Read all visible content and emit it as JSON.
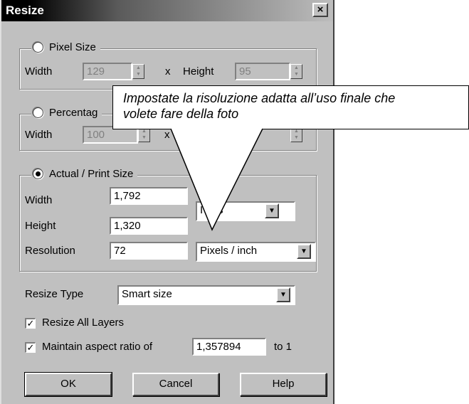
{
  "window": {
    "title": "Resize",
    "close_glyph": "×"
  },
  "pixel_size": {
    "label": "Pixel Size",
    "width_label": "Width",
    "width_value": "129",
    "x_sep": "x",
    "height_label": "Height",
    "height_value": "95"
  },
  "percentage": {
    "label": "Percentag",
    "width_label": "Width",
    "width_value": "100",
    "x_sep": "x"
  },
  "actual": {
    "label": "Actual / Print Size",
    "width_label": "Width",
    "width_value": "1,792",
    "height_label": "Height",
    "height_value": "1,320",
    "resolution_label": "Resolution",
    "resolution_value": "72",
    "units_value": "Inches",
    "units_visible": "I    hes",
    "res_units_value": "Pixels / inch"
  },
  "resize_type": {
    "label": "Resize Type",
    "value": "Smart size"
  },
  "resize_all_layers": {
    "label": "Resize All Layers",
    "checked": true
  },
  "aspect": {
    "label": "Maintain aspect ratio of",
    "value": "1,357894",
    "suffix": "to 1",
    "checked": true
  },
  "buttons": {
    "ok": "OK",
    "cancel": "Cancel",
    "help": "Help"
  },
  "callout": {
    "line1": "Impostate la risoluzione adatta all’uso finale che",
    "line2": "volete fare della foto"
  },
  "icons": {
    "spin": "spin-arrows-icon",
    "dropdown": "chevron-down-icon",
    "check": "checkmark-icon"
  },
  "colors": {
    "dialog": "#c0c0c0",
    "title_bar": "#000000",
    "disabled_text": "#808080"
  }
}
